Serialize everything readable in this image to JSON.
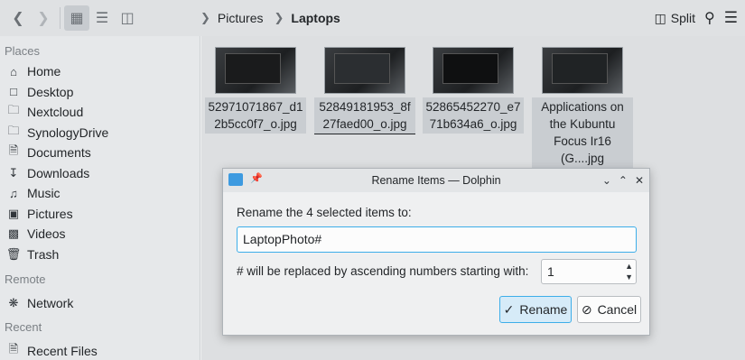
{
  "toolbar": {
    "breadcrumb": [
      "Pictures",
      "Laptops"
    ],
    "split_label": "Split"
  },
  "sidebar": {
    "sections": [
      {
        "title": "Places",
        "items": [
          {
            "label": "Home",
            "icon": "home-icon"
          },
          {
            "label": "Desktop",
            "icon": "desktop-icon"
          },
          {
            "label": "Nextcloud",
            "icon": "folder-icon"
          },
          {
            "label": "SynologyDrive",
            "icon": "folder-icon"
          },
          {
            "label": "Documents",
            "icon": "documents-icon"
          },
          {
            "label": "Downloads",
            "icon": "downloads-icon"
          },
          {
            "label": "Music",
            "icon": "music-icon"
          },
          {
            "label": "Pictures",
            "icon": "pictures-icon"
          },
          {
            "label": "Videos",
            "icon": "videos-icon"
          },
          {
            "label": "Trash",
            "icon": "trash-icon"
          }
        ]
      },
      {
        "title": "Remote",
        "items": [
          {
            "label": "Network",
            "icon": "network-icon"
          }
        ]
      },
      {
        "title": "Recent",
        "items": [
          {
            "label": "Recent Files",
            "icon": "recent-files-icon"
          }
        ]
      }
    ]
  },
  "files": [
    {
      "name": "52971071867_d12b5cc0f7_o.jpg"
    },
    {
      "name": "52849181953_8f27faed00_o.jpg"
    },
    {
      "name": "52865452270_e771b634a6_o.jpg"
    },
    {
      "name": "Applications on the Kubuntu Focus Ir16 (G....jpg"
    }
  ],
  "dialog": {
    "title": "Rename Items — Dolphin",
    "prompt": "Rename the 4 selected items to:",
    "name_value": "LaptopPhoto#",
    "number_label": "# will be replaced by ascending numbers starting with:",
    "start_number": "1",
    "rename_label": "Rename",
    "cancel_label": "Cancel"
  }
}
